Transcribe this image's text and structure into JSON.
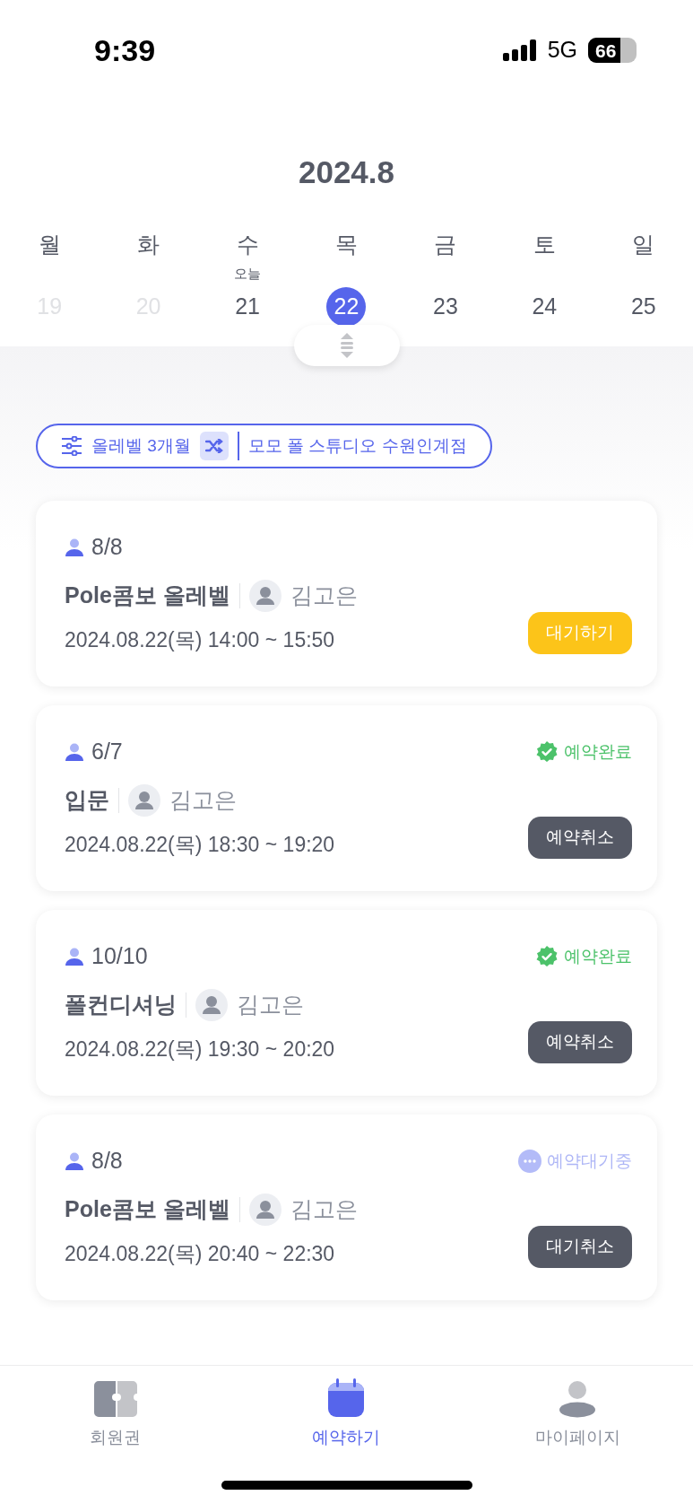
{
  "status_bar": {
    "time": "9:39",
    "network": "5G",
    "battery": "66"
  },
  "calendar": {
    "title": "2024.8",
    "days": [
      {
        "weekday": "월",
        "date": "19",
        "disabled": true,
        "selected": false
      },
      {
        "weekday": "화",
        "date": "20",
        "disabled": true,
        "selected": false
      },
      {
        "weekday": "수",
        "date": "21",
        "today_label": "오늘",
        "disabled": false,
        "selected": false
      },
      {
        "weekday": "목",
        "date": "22",
        "disabled": false,
        "selected": true
      },
      {
        "weekday": "금",
        "date": "23",
        "disabled": false,
        "selected": false
      },
      {
        "weekday": "토",
        "date": "24",
        "disabled": false,
        "selected": false
      },
      {
        "weekday": "일",
        "date": "25",
        "disabled": false,
        "selected": false
      }
    ]
  },
  "filter": {
    "pass": "올레벨 3개월",
    "studio": "모모 폴 스튜디오 수원인계점"
  },
  "classes": [
    {
      "count": "8/8",
      "title": "Pole콤보 올레벨",
      "instructor": "김고은",
      "datetime": "2024.08.22(목) 14:00 ~ 15:50",
      "button": {
        "label": "대기하기",
        "kind": "waitlist"
      }
    },
    {
      "count": "6/7",
      "title": "입문",
      "instructor": "김고은",
      "datetime": "2024.08.22(목) 18:30 ~ 19:20",
      "status": {
        "label": "예약완료",
        "kind": "confirmed"
      },
      "button": {
        "label": "예약취소",
        "kind": "cancel"
      }
    },
    {
      "count": "10/10",
      "title": "폴컨디셔닝",
      "instructor": "김고은",
      "datetime": "2024.08.22(목) 19:30 ~ 20:20",
      "status": {
        "label": "예약완료",
        "kind": "confirmed"
      },
      "button": {
        "label": "예약취소",
        "kind": "cancel"
      }
    },
    {
      "count": "8/8",
      "title": "Pole콤보 올레벨",
      "instructor": "김고은",
      "datetime": "2024.08.22(목) 20:40 ~ 22:30",
      "status": {
        "label": "예약대기중",
        "kind": "waiting"
      },
      "button": {
        "label": "대기취소",
        "kind": "cancel"
      }
    }
  ],
  "nav": [
    {
      "label": "회원권",
      "kind": "ticket",
      "selected": false
    },
    {
      "label": "예약하기",
      "kind": "calendar",
      "selected": true
    },
    {
      "label": "마이페이지",
      "kind": "profile",
      "selected": false
    }
  ]
}
